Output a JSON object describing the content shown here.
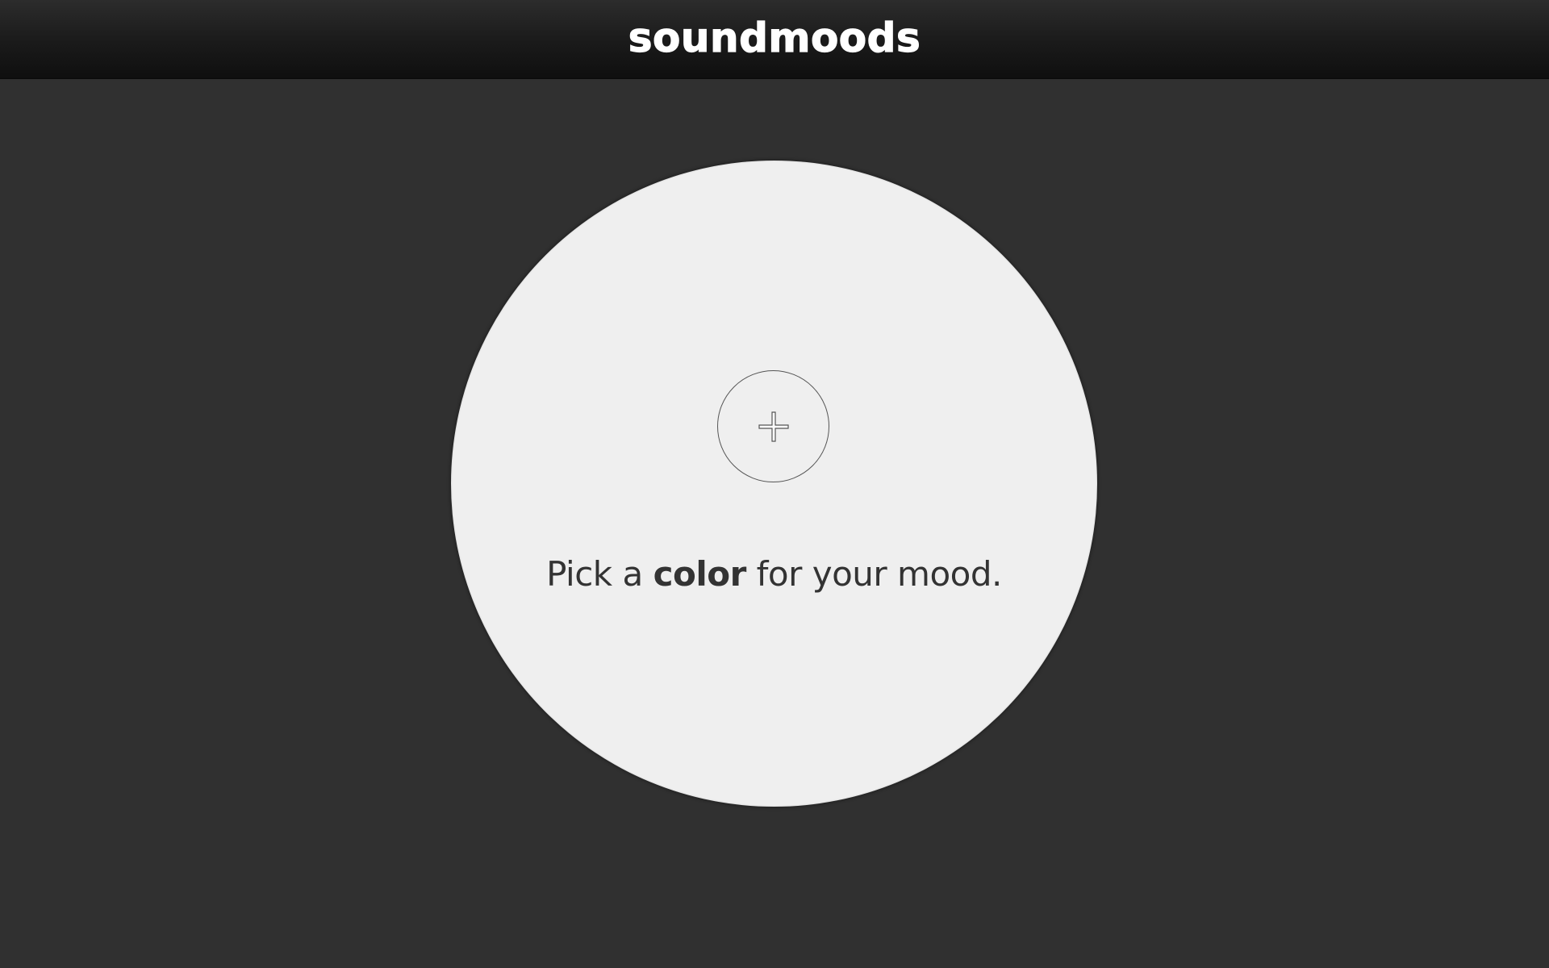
{
  "header": {
    "logo_text": "soundmoods"
  },
  "main": {
    "add_button_icon": "plus-icon",
    "prompt": {
      "before": "Pick a ",
      "emphasis": "color",
      "after": " for your mood."
    }
  },
  "colors": {
    "background": "#303030",
    "header": "#1a1a1a",
    "disc": "#efefef",
    "text": "#333333",
    "logo": "#ffffff"
  }
}
